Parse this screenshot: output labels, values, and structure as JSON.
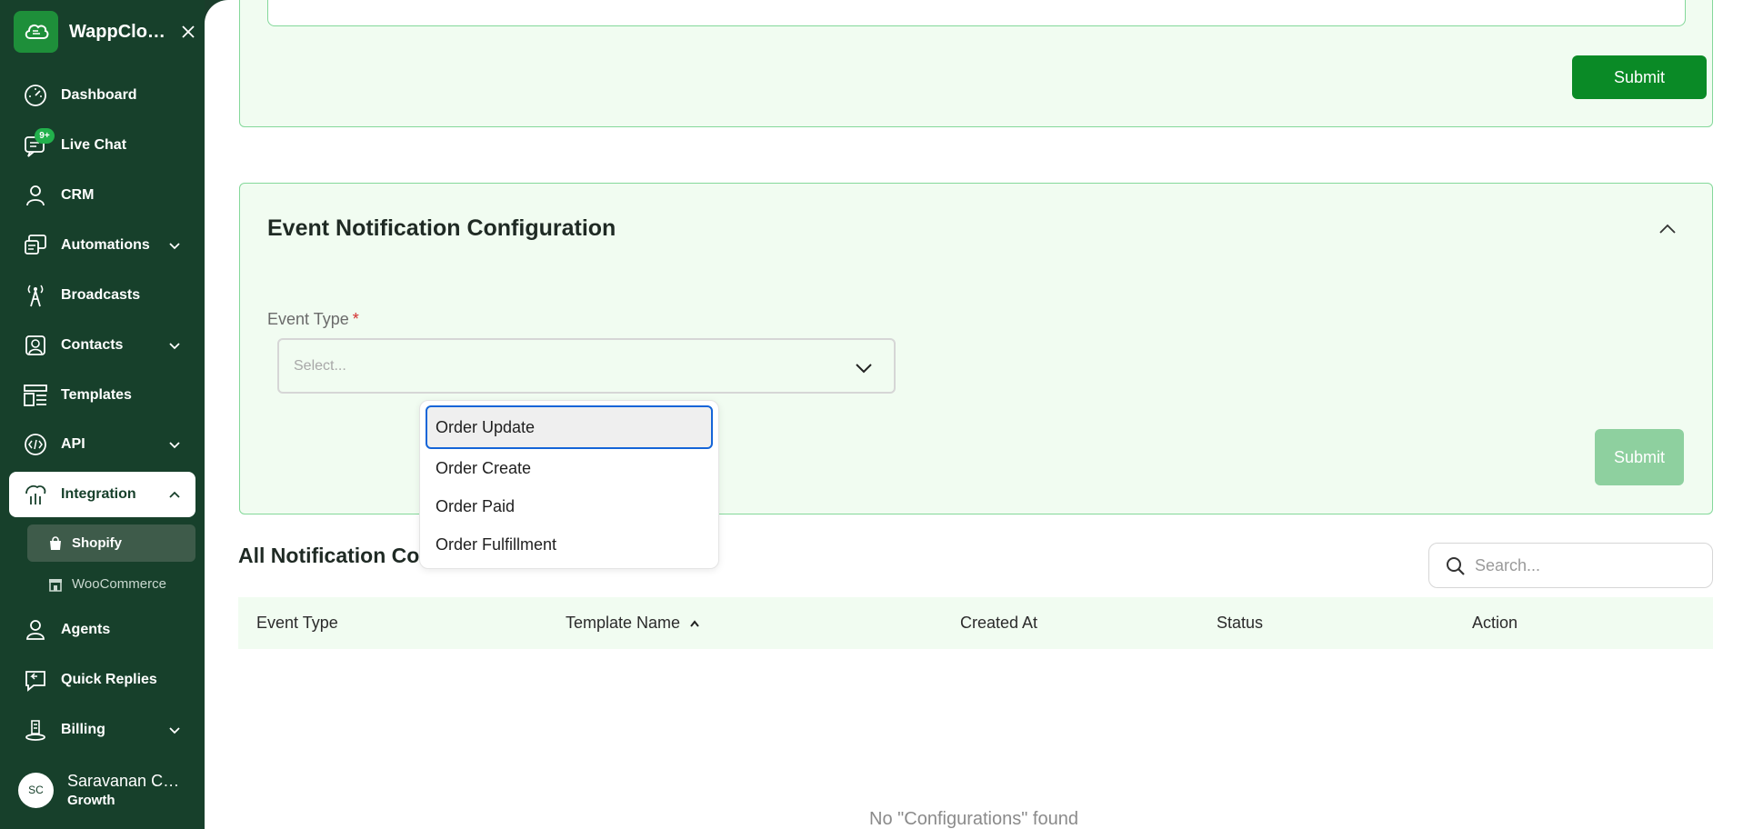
{
  "app": {
    "name": "WappCloud..."
  },
  "sidebar": {
    "items": [
      {
        "label": "Dashboard",
        "icon": "dashboard-gauge-icon"
      },
      {
        "label": "Live Chat",
        "icon": "chat-icon",
        "badge": "9+"
      },
      {
        "label": "CRM",
        "icon": "crm-users-icon"
      },
      {
        "label": "Automations",
        "icon": "automations-icon",
        "has_submenu": true
      },
      {
        "label": "Broadcasts",
        "icon": "broadcast-tower-icon"
      },
      {
        "label": "Contacts",
        "icon": "contacts-icon",
        "has_submenu": true
      },
      {
        "label": "Templates",
        "icon": "templates-icon"
      },
      {
        "label": "API",
        "icon": "api-code-icon",
        "has_submenu": true
      },
      {
        "label": "Integration",
        "icon": "integration-icon",
        "has_submenu": true,
        "expanded": true,
        "active": true
      },
      {
        "label": "Agents",
        "icon": "agents-icon"
      },
      {
        "label": "Quick Replies",
        "icon": "quick-replies-icon"
      },
      {
        "label": "Billing",
        "icon": "billing-icon",
        "has_submenu": true
      }
    ],
    "subitems": [
      {
        "label": "Shopify",
        "icon": "shopping-bag-icon",
        "selected": true
      },
      {
        "label": "WooCommerce",
        "icon": "store-icon"
      }
    ]
  },
  "user": {
    "initials": "SC",
    "name": "Saravanan Co...",
    "plan": "Growth"
  },
  "top_card": {
    "submit_label": "Submit"
  },
  "event_config": {
    "title": "Event Notification Configuration",
    "field_label": "Event Type",
    "required_mark": "*",
    "select_placeholder": "Select...",
    "submit_label": "Submit",
    "options": [
      "Order Update",
      "Order Create",
      "Order Paid",
      "Order Fulfillment"
    ],
    "focused_option": "Order Update"
  },
  "list": {
    "title": "All Notification Con",
    "search_placeholder": "Search...",
    "columns": [
      "Event Type",
      "Template Name",
      "Created At",
      "Status",
      "Action"
    ],
    "sorted_column": "Template Name",
    "sort_direction": "ascending",
    "empty_message": "No \"Configurations\" found"
  },
  "colors": {
    "sidebar_bg": "#17402b",
    "primary": "#0a8a26",
    "card_bg": "#f1fcf1",
    "card_border": "#84d89a",
    "badge": "#22b14c",
    "focus_ring": "#1565d8"
  }
}
